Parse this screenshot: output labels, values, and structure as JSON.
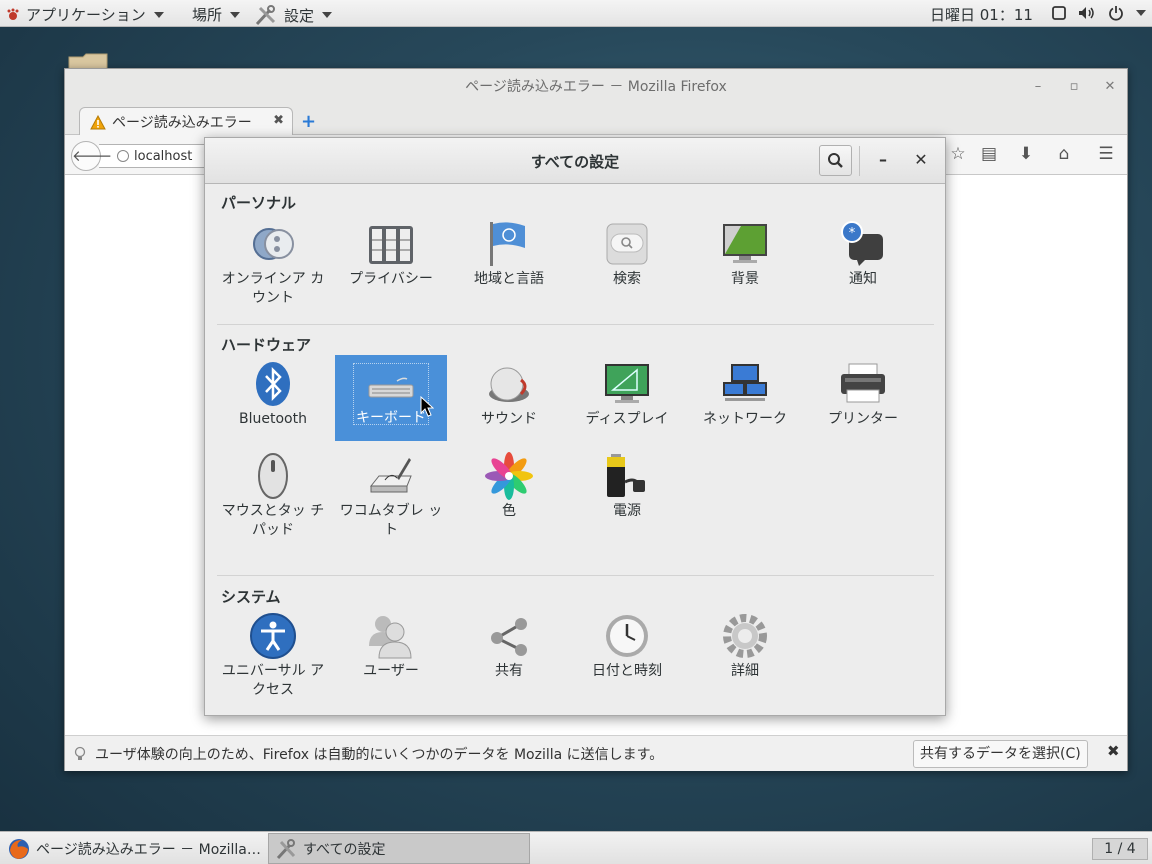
{
  "top_panel": {
    "applications": "アプリケーション",
    "places": "場所",
    "settings": "設定",
    "clock": "日曜日 01：11"
  },
  "firefox": {
    "title": "ページ読み込みエラー － Mozilla Firefox",
    "tab_title": "ページ読み込みエラー",
    "url": "localhost",
    "notification_text": "ユーザ体験の向上のため、Firefox は自動的にいくつかのデータを Mozilla に送信します。",
    "notification_button": "共有するデータを選択(C)"
  },
  "settings": {
    "title": "すべての設定",
    "sections": [
      {
        "title": "パーソナル",
        "items": [
          {
            "label": "オンラインア カウント",
            "icon": "online-accounts-icon"
          },
          {
            "label": "プライバシー",
            "icon": "privacy-icon"
          },
          {
            "label": "地域と言語",
            "icon": "region-language-icon"
          },
          {
            "label": "検索",
            "icon": "search-settings-icon"
          },
          {
            "label": "背景",
            "icon": "background-icon"
          },
          {
            "label": "通知",
            "icon": "notifications-icon"
          }
        ]
      },
      {
        "title": "ハードウェア",
        "items": [
          {
            "label": "Bluetooth",
            "icon": "bluetooth-icon"
          },
          {
            "label": "キーボード",
            "icon": "keyboard-icon",
            "selected": true
          },
          {
            "label": "サウンド",
            "icon": "sound-icon"
          },
          {
            "label": "ディスプレイ",
            "icon": "display-icon"
          },
          {
            "label": "ネットワーク",
            "icon": "network-icon"
          },
          {
            "label": "プリンター",
            "icon": "printer-icon"
          },
          {
            "label": "マウスとタッ チパッド",
            "icon": "mouse-touchpad-icon"
          },
          {
            "label": "ワコムタブレ ット",
            "icon": "wacom-tablet-icon"
          },
          {
            "label": "色",
            "icon": "color-icon"
          },
          {
            "label": "電源",
            "icon": "power-icon"
          }
        ]
      },
      {
        "title": "システム",
        "items": [
          {
            "label": "ユニバーサル アクセス",
            "icon": "universal-access-icon"
          },
          {
            "label": "ユーザー",
            "icon": "users-icon"
          },
          {
            "label": "共有",
            "icon": "sharing-icon"
          },
          {
            "label": "日付と時刻",
            "icon": "date-time-icon"
          },
          {
            "label": "詳細",
            "icon": "details-icon"
          }
        ]
      }
    ]
  },
  "taskbar": {
    "firefox_task": "ページ読み込みエラー － Mozilla…",
    "settings_task": "すべての設定",
    "workspace": "1 / 4"
  }
}
